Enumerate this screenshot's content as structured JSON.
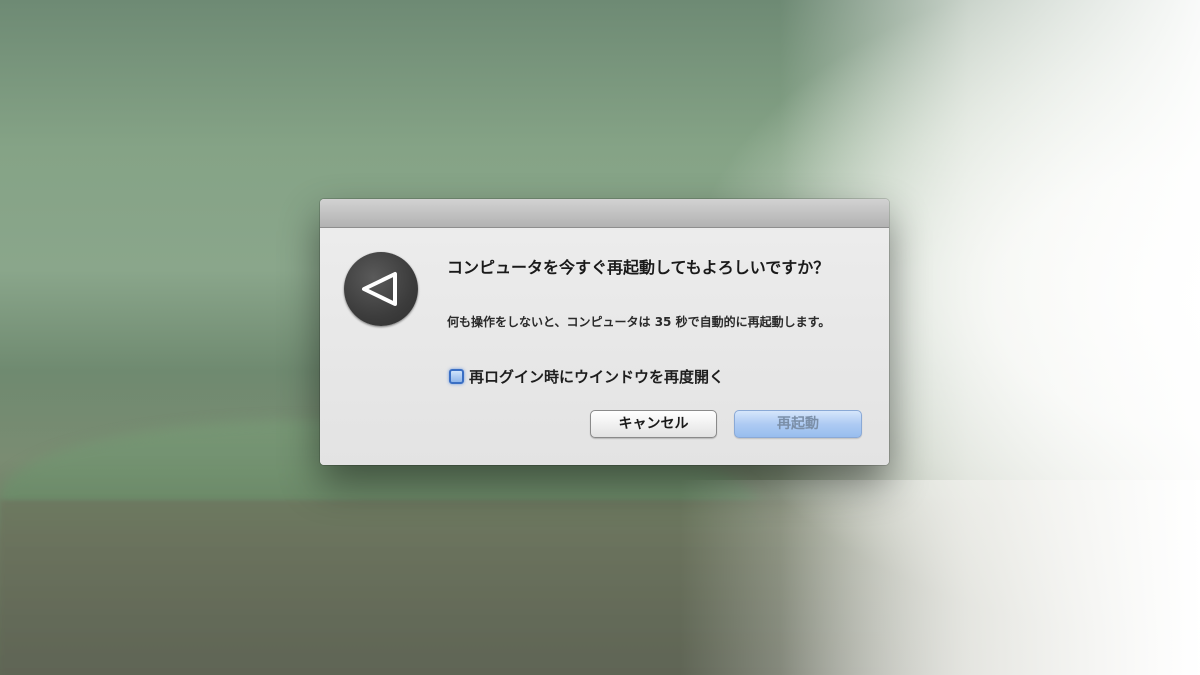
{
  "dialog": {
    "title": "コンピュータを今すぐ再起動してもよろしいですか？",
    "message": "何も操作をしないと、コンピュータは 35 秒で自動的に再起動します。",
    "checkbox_label": "再ログイン時にウインドウを再度開く",
    "checkbox_checked": true,
    "cancel_label": "キャンセル",
    "restart_label": "再起動",
    "icon": "restart-icon"
  }
}
